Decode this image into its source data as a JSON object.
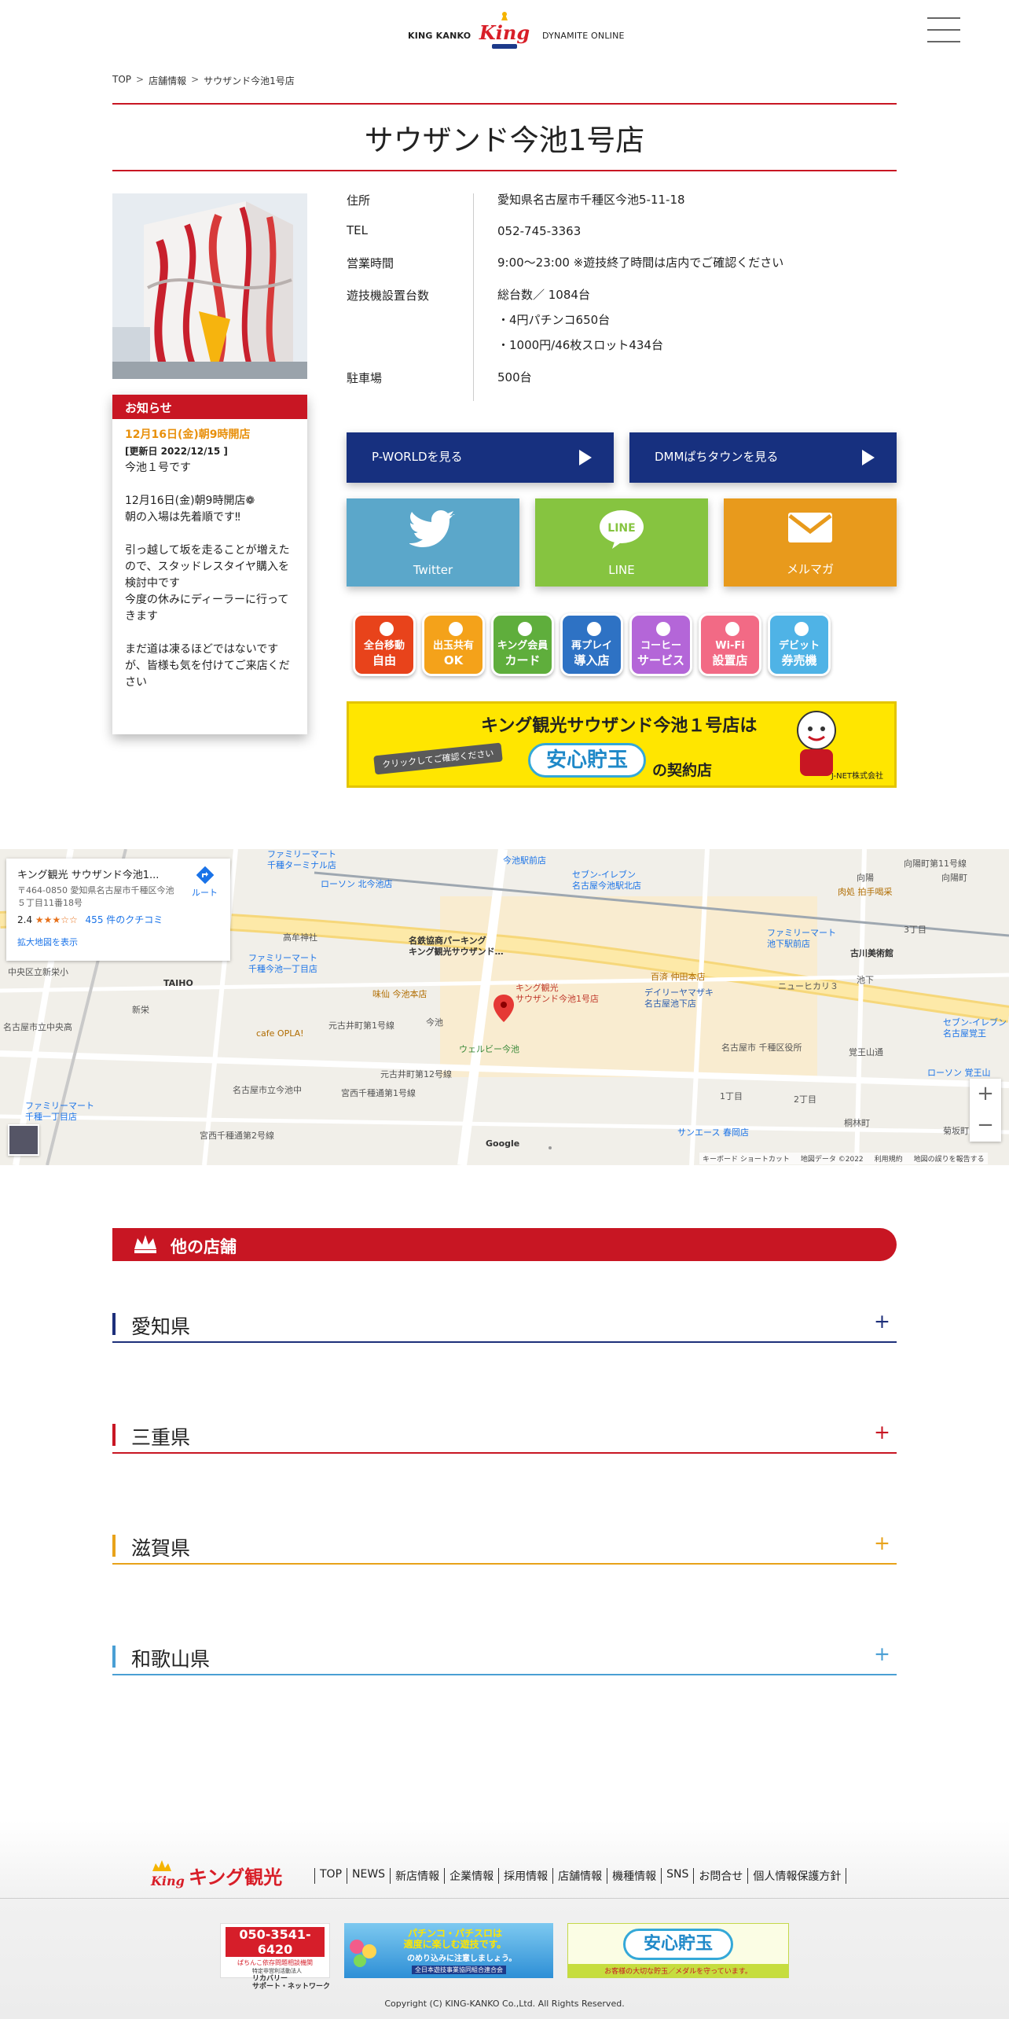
{
  "header": {
    "brand_left": "KING KANKO",
    "brand_right": "DYNAMITE ONLINE",
    "logo_text": "King"
  },
  "breadcrumb": {
    "top": "TOP",
    "stores": "店舗情報",
    "current": "サウザンド今池1号店",
    "separator": ">"
  },
  "store": {
    "title": "サウザンド今池1号店",
    "info": [
      {
        "label": "住所",
        "value": "愛知県名古屋市千種区今池5-11-18"
      },
      {
        "label": "TEL",
        "value": "052-745-3363"
      },
      {
        "label": "営業時間",
        "value": "9:00～23:00 ※遊技終了時間は店内でご確認ください"
      },
      {
        "label": "遊技機設置台数",
        "value": "総台数／ 1084台\n・4円パチンコ650台\n・1000円/46枚スロット434台"
      },
      {
        "label": "駐車場",
        "value": "500台"
      }
    ]
  },
  "notice": {
    "heading": "お知らせ",
    "date_title": "12月16日(金)朝9時開店",
    "updated": "[更新日 2022/12/15 ]",
    "body": "今池１号です\n\n12月16日(金)朝9時開店❁\n朝の入場は先着順です‼\n\n引っ越して坂を走ることが増えたので、スタッドレスタイヤ購入を検討中です\n今度の休みにディーラーに行ってきます\n\nまだ道は凍るほどではないですが、皆様も気を付けてご来店ください"
  },
  "links": {
    "pworld": "P-WORLDを見る",
    "dmm": "DMMぱちタウンを見る",
    "twitter": "Twitter",
    "line": "LINE",
    "mail": "メルマガ"
  },
  "features": [
    {
      "line1": "全台移動",
      "line2": "自由",
      "color": "#e8431b",
      "icon": "chair-icon"
    },
    {
      "line1": "出玉共有",
      "line2": "OK",
      "color": "#f4a21a",
      "icon": "share-icon"
    },
    {
      "line1": "キング会員",
      "line2": "カード",
      "color": "#5fae3c",
      "icon": "card-icon"
    },
    {
      "line1": "再プレイ",
      "line2": "導入店",
      "color": "#2e72c4",
      "icon": "replay-icon"
    },
    {
      "line1": "コーヒー",
      "line2": "サービス",
      "color": "#b466d8",
      "icon": "coffee-icon"
    },
    {
      "line1": "Wi-Fi",
      "line2": "設置店",
      "color": "#f26a85",
      "icon": "wifi-icon"
    },
    {
      "line1": "デビット",
      "line2": "券売機",
      "color": "#4fb3e6",
      "icon": "debit-icon"
    }
  ],
  "jnet_banner": {
    "title": "キング観光サウザンド今池１号店は",
    "click": "クリックしてご確認ください",
    "anshin": "安心貯玉",
    "store_suffix": "の契約店",
    "company": "J-NET株式会社"
  },
  "map": {
    "place_name": "キング観光 サウザンド今池1...",
    "address": "〒464-0850 愛知県名古屋市千種区今池５丁目11番18号",
    "rating": "2.4",
    "stars": "★★★☆☆",
    "reviews": "455 件のクチコミ",
    "route": "ルート",
    "enlarge": "拡大地図を表示",
    "zoom_in": "+",
    "zoom_out": "−",
    "footer": [
      "キーボード ショートカット",
      "地図データ ©2022",
      "利用規約",
      "地図の誤りを報告する"
    ],
    "labels": [
      "キング観光\nサウザンド今池1号店",
      "名鉄協商パーキング\nキング観光サウザンド…",
      "ファミリーマート\n千種ターミナル店",
      "ローソン 北今池店",
      "今池駅前店",
      "セブン-イレブン\n名古屋今池駅北店",
      "向陽町",
      "向陽",
      "肉処 拍手喝采",
      "ファミリーマート\n池下駅前店",
      "古川美術館",
      "高牟神社",
      "ファミリーマート\n千種今池一丁目店",
      "TAIHO",
      "新栄",
      "味仙 今池本店",
      "今池",
      "cafe OPLA!",
      "元古井町第1号線",
      "元古井町第12号線",
      "ウェルビー今池",
      "百済 仲田本店",
      "デイリーヤマザキ\n名古屋池下店",
      "ニューヒカリ３",
      "池下",
      "名古屋市 千種区役所",
      "覚王山通",
      "ローソン 覚王山",
      "名古屋市立今池中",
      "宮西千種通第1号線",
      "宮西千種通第2号線",
      "サンエース 春岡店",
      "ファミリーマート\n千種一丁目店",
      "名古屋市立中央高",
      "Google",
      "桐林町",
      "菊坂町",
      "1丁目",
      "2丁目",
      "3丁目",
      "中央区立新栄小",
      "向陽町第11号線",
      "セブン-イレブン\n名古屋覚王"
    ]
  },
  "other_stores": {
    "heading": "他の店舗",
    "prefectures": [
      {
        "name": "愛知県",
        "color": "#1d2f7a"
      },
      {
        "name": "三重県",
        "color": "#c81623"
      },
      {
        "name": "滋賀県",
        "color": "#e8a21a"
      },
      {
        "name": "和歌山県",
        "color": "#4a9fd4"
      }
    ],
    "expand": "+"
  },
  "footer": {
    "logo_text": "キング観光",
    "nav": [
      "TOP",
      "NEWS",
      "新店情報",
      "企業情報",
      "採用情報",
      "店舗情報",
      "機種情報",
      "SNS",
      "お問合せ",
      "個人情報保護方針"
    ],
    "banners": {
      "recovery_tel": "050-3541-6420",
      "recovery_sub": "ぱちんこ依存問題相談機関",
      "recovery_org": "特定非営利活動法人",
      "recovery_name": "リカバリー\nサポート・ネットワーク",
      "fair_title": "パチンコ・パチスロは\n適度に楽しむ遊技です。",
      "fair_sub": "のめり込みに注意しましょう。",
      "fair_org": "全日本遊技事業協同組合連合会",
      "anshin_title": "安心貯玉",
      "anshin_sub": "お客様の大切な貯玉／メダルを守っています。"
    },
    "copyright": "Copyright (C) KING-KANKO Co.,Ltd. All Rights Reserved."
  }
}
